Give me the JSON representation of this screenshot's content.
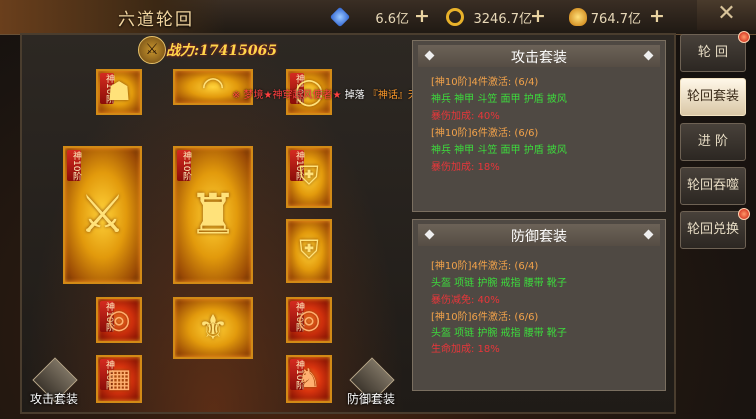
{
  "window": {
    "title": "六道轮回",
    "close_glyph": "✕"
  },
  "resources": [
    {
      "name": "diamond",
      "icon": "diamond-icon",
      "value": "6.6亿",
      "color": "#3a7ef0"
    },
    {
      "name": "ring-currency",
      "icon": "gold-ring-icon",
      "value": "3246.7亿",
      "color": "#e8b22a"
    },
    {
      "name": "gold-ingot",
      "icon": "gold-ingot-icon",
      "value": "764.7亿",
      "color": "#f0a01a"
    }
  ],
  "power": {
    "text": "战力:17415065"
  },
  "marquee": {
    "part1": "※ 梦境★神穿越风使者★",
    "part2": "掉落",
    "part3": "『神话』天命项链",
    "part4": "。"
  },
  "slot_badge": "神10阶",
  "slots": [
    {
      "id": "helmet",
      "icon": "helmet-icon",
      "glyph": "☗",
      "style": "red"
    },
    {
      "id": "necklace",
      "icon": "necklace-icon",
      "glyph": "◠",
      "style": "gold"
    },
    {
      "id": "bracelet-top",
      "icon": "bracelet-icon",
      "glyph": "◯",
      "style": "red"
    },
    {
      "id": "weapon",
      "icon": "sword-icon",
      "glyph": "⚔",
      "style": "gold"
    },
    {
      "id": "armor",
      "icon": "armor-icon",
      "glyph": "♜",
      "style": "gold"
    },
    {
      "id": "shield-top",
      "icon": "shield-icon",
      "glyph": "⛨",
      "style": "gold"
    },
    {
      "id": "shield-bottom",
      "icon": "shield-icon",
      "glyph": "⛨",
      "style": "gold"
    },
    {
      "id": "ring-left",
      "icon": "ring-icon",
      "glyph": "◎",
      "style": "red"
    },
    {
      "id": "cloak",
      "icon": "cloak-icon",
      "glyph": "⚜",
      "style": "gold"
    },
    {
      "id": "ring-right",
      "icon": "ring-icon",
      "glyph": "◎",
      "style": "red"
    },
    {
      "id": "belt",
      "icon": "belt-icon",
      "glyph": "▦",
      "style": "red"
    },
    {
      "id": "boots",
      "icon": "boots-icon",
      "glyph": "♞",
      "style": "red"
    }
  ],
  "set_buttons": {
    "attack": "攻击套装",
    "defense": "防御套装"
  },
  "attack_set": {
    "title": "攻击套装",
    "lines": [
      {
        "text": "[神10阶]4件激活: (6/4)",
        "color": "orange"
      },
      {
        "text": "神兵 神甲 斗笠 面甲 护盾 披风",
        "color": "green"
      },
      {
        "text": "暴伤加成: 40%",
        "color": "red"
      },
      {
        "text": "[神10阶]6件激活: (6/6)",
        "color": "orange"
      },
      {
        "text": "神兵 神甲 斗笠 面甲 护盾 披风",
        "color": "green"
      },
      {
        "text": "暴伤加成: 18%",
        "color": "red"
      }
    ]
  },
  "defense_set": {
    "title": "防御套装",
    "lines": [
      {
        "text": "[神10阶]4件激活: (6/4)",
        "color": "orange"
      },
      {
        "text": "头盔 项链 护腕 戒指 腰带 靴子",
        "color": "green"
      },
      {
        "text": "暴伤减免: 40%",
        "color": "red"
      },
      {
        "text": "[神10阶]6件激活: (6/6)",
        "color": "orange"
      },
      {
        "text": "头盔 项链 护腕 戒指 腰带 靴子",
        "color": "green"
      },
      {
        "text": "生命加成: 18%",
        "color": "red"
      }
    ]
  },
  "tabs": [
    {
      "label": "轮 回",
      "active": false,
      "dot": true
    },
    {
      "label": "轮回套装",
      "active": true,
      "dot": false
    },
    {
      "label": "进 阶",
      "active": false,
      "dot": false
    },
    {
      "label": "轮回吞噬",
      "active": false,
      "dot": false
    },
    {
      "label": "轮回兑换",
      "active": false,
      "dot": true
    }
  ]
}
